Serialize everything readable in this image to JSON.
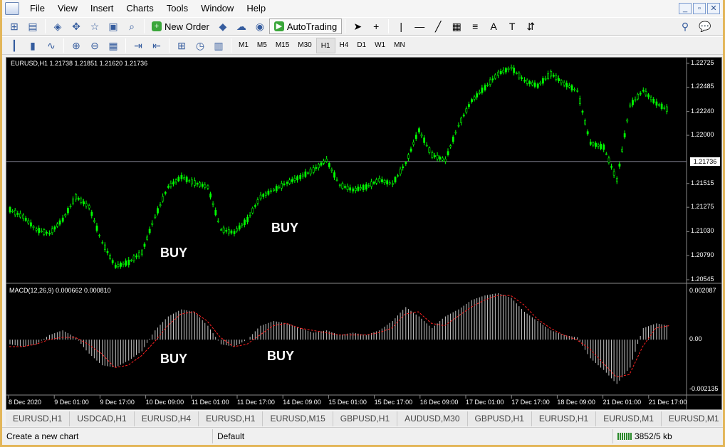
{
  "menu": [
    "File",
    "View",
    "Insert",
    "Charts",
    "Tools",
    "Window",
    "Help"
  ],
  "window_buttons": [
    "_",
    "▫",
    "✕"
  ],
  "toolbar1": {
    "new_order": "New Order",
    "autotrading": "AutoTrading"
  },
  "timeframes": [
    "M1",
    "M5",
    "M15",
    "M30",
    "H1",
    "H4",
    "D1",
    "W1",
    "MN"
  ],
  "active_timeframe": "H1",
  "chart": {
    "header": "EURUSD,H1  1.21738 1.21851 1.21620 1.21736",
    "current_price": "1.21736",
    "price_ticks": [
      "1.22725",
      "1.22485",
      "1.22240",
      "1.22000",
      "1.21736",
      "1.21515",
      "1.21275",
      "1.21030",
      "1.20790",
      "1.20545"
    ],
    "macd_header": "MACD(12,26,9) 0.000662 0.000810",
    "macd_ticks": [
      "0.002087",
      "0.00",
      "-0.002135"
    ],
    "time_ticks": [
      "8 Dec 2020",
      "9 Dec 01:00",
      "9 Dec 17:00",
      "10 Dec 09:00",
      "11 Dec 01:00",
      "11 Dec 17:00",
      "14 Dec 09:00",
      "15 Dec 01:00",
      "15 Dec 17:00",
      "16 Dec 09:00",
      "17 Dec 01:00",
      "17 Dec 17:00",
      "18 Dec 09:00",
      "21 Dec 01:00",
      "21 Dec 17:00"
    ],
    "annotations": [
      "BUY",
      "BUY",
      "BUY",
      "BUY"
    ],
    "colors": {
      "candle": "#00ff00",
      "signal": "#ff2020",
      "histogram": "#c8c8c8"
    }
  },
  "chart_data": {
    "type": "line",
    "symbol": "EURUSD",
    "timeframe": "H1",
    "ylim": [
      1.20545,
      1.22725
    ],
    "series": [
      {
        "name": "EURUSD",
        "values": [
          1.2125,
          1.2118,
          1.2105,
          1.2101,
          1.2115,
          1.2138,
          1.2128,
          1.2092,
          1.2068,
          1.2072,
          1.2082,
          1.2118,
          1.2148,
          1.2158,
          1.2152,
          1.2148,
          1.2105,
          1.2102,
          1.2115,
          1.2138,
          1.2145,
          1.2152,
          1.2158,
          1.2165,
          1.2175,
          1.215,
          1.2145,
          1.2148,
          1.2155,
          1.2151,
          1.2172,
          1.2205,
          1.218,
          1.2175,
          1.221,
          1.2235,
          1.2248,
          1.2262,
          1.2268,
          1.2255,
          1.225,
          1.2262,
          1.2252,
          1.2245,
          1.2192,
          1.2188,
          1.2155,
          1.223,
          1.2245,
          1.2232,
          1.2225
        ]
      }
    ],
    "macd": {
      "histogram": [
        -0.0002,
        -0.0003,
        -0.0002,
        0.0002,
        0.0004,
        0.0001,
        -0.0006,
        -0.0011,
        -0.0012,
        -0.0009,
        -0.0005,
        0.0004,
        0.001,
        0.0013,
        0.0012,
        0.0006,
        -0.0002,
        -0.0003,
        0.0,
        0.0006,
        0.0008,
        0.0007,
        0.0005,
        0.0003,
        0.0004,
        0.0002,
        0.0003,
        0.0002,
        0.0004,
        0.0008,
        0.0014,
        0.001,
        0.0005,
        0.001,
        0.0013,
        0.0017,
        0.0019,
        0.002,
        0.0018,
        0.0012,
        0.0008,
        0.0004,
        0.0002,
        0.0001,
        -0.0008,
        -0.0013,
        -0.0019,
        -0.0012,
        0.0005,
        0.0007,
        0.0006
      ],
      "signal": [
        -0.0003,
        -0.0003,
        -0.0002,
        0.0,
        0.0001,
        0.0001,
        -0.0002,
        -0.0006,
        -0.0012,
        -0.0011,
        -0.0007,
        -0.0001,
        0.0006,
        0.0011,
        0.0012,
        0.0008,
        0.0001,
        -0.0003,
        -0.0002,
        0.0002,
        0.0006,
        0.0007,
        0.0005,
        0.0004,
        0.0003,
        0.0002,
        0.0002,
        0.0002,
        0.0003,
        0.0005,
        0.0011,
        0.0012,
        0.0007,
        0.0006,
        0.001,
        0.0014,
        0.0017,
        0.0019,
        0.0019,
        0.0015,
        0.0009,
        0.0005,
        0.0002,
        0.0,
        -0.0004,
        -0.001,
        -0.0016,
        -0.0015,
        -0.0003,
        0.0005,
        0.0006
      ]
    }
  },
  "tabs": [
    "EURUSD,H1",
    "USDCAD,H1",
    "EURUSD,H4",
    "EURUSD,H1",
    "EURUSD,M15",
    "GBPUSD,H1",
    "AUDUSD,M30",
    "GBPUSD,H1",
    "EURUSD,H1",
    "EURUSD,M1",
    "EURUSD,M1"
  ],
  "status": {
    "hint": "Create a new chart",
    "profile": "Default",
    "traffic": "3852/5 kb"
  }
}
